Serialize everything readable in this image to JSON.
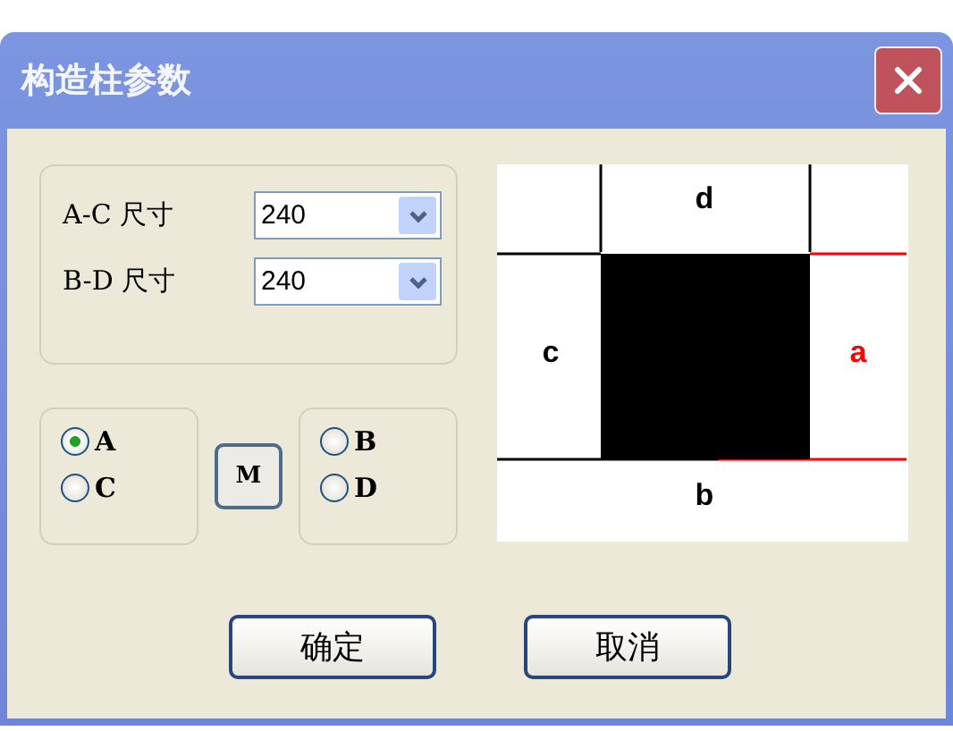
{
  "window": {
    "title": "构造柱参数"
  },
  "sizes": [
    {
      "label": "A-C 尺寸",
      "value": "240"
    },
    {
      "label": "B-D 尺寸",
      "value": "240"
    }
  ],
  "radio_groups": [
    [
      {
        "label": "A",
        "selected": true
      },
      {
        "label": "C",
        "selected": false
      }
    ],
    [
      {
        "label": "B",
        "selected": false
      },
      {
        "label": "D",
        "selected": false
      }
    ]
  ],
  "middle_button": "M",
  "diagram_labels": [
    {
      "kind": "top",
      "text": "d",
      "color": "#000000"
    },
    {
      "kind": "left",
      "text": "c",
      "color": "#000000"
    },
    {
      "kind": "right",
      "text": "a",
      "color": "#ff0000"
    },
    {
      "kind": "bottom",
      "text": "b",
      "color": "#000000"
    }
  ],
  "buttons": [
    "确定",
    "取消"
  ]
}
